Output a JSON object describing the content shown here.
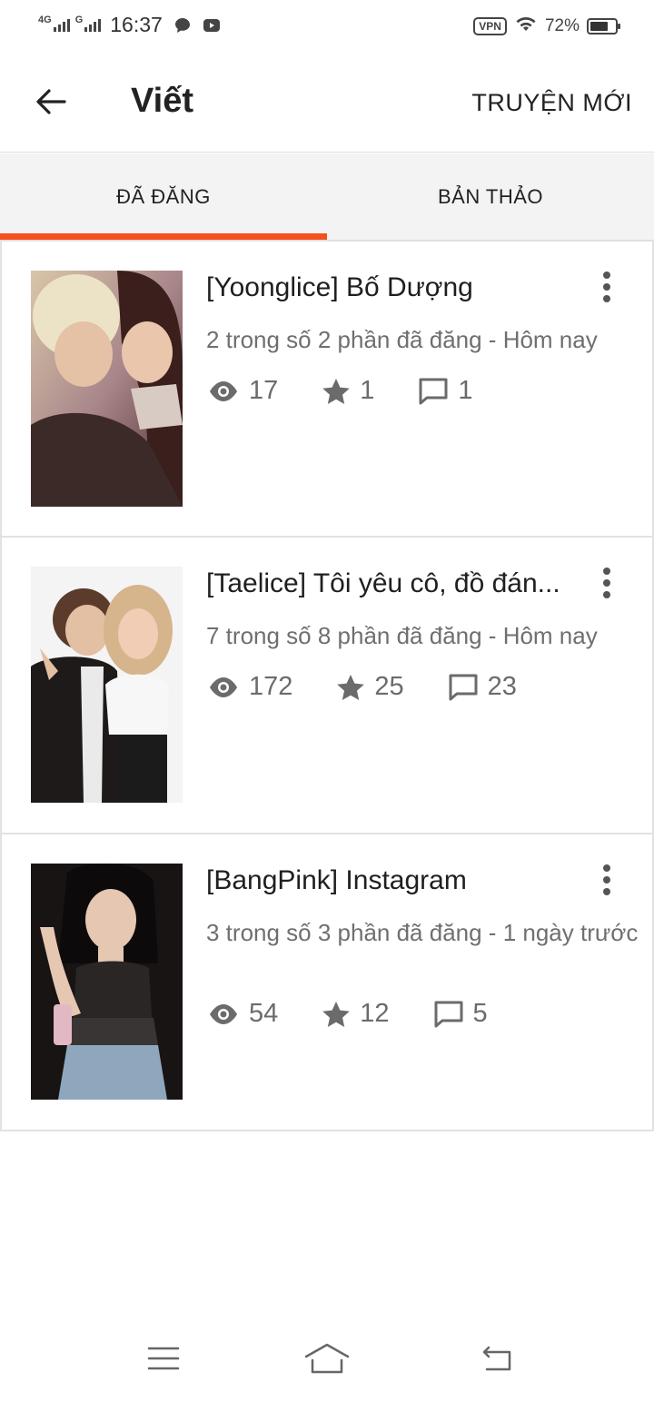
{
  "status_bar": {
    "network_1": "4G",
    "network_2": "G",
    "time": "16:37",
    "vpn": "VPN",
    "battery_percent": "72%",
    "battery_level": 0.72
  },
  "app_bar": {
    "title": "Viết",
    "new_story_label": "TRUYỆN MỚI"
  },
  "tabs": [
    {
      "label": "ĐÃ ĐĂNG",
      "active": true
    },
    {
      "label": "BẢN THẢO",
      "active": false
    }
  ],
  "stories": [
    {
      "title": "[Yoonglice] Bố Dượng",
      "meta": "2 trong số 2 phần đã đăng - Hôm nay",
      "views": "17",
      "votes": "1",
      "comments": "1"
    },
    {
      "title": "[Taelice] Tôi yêu cô, đồ đán...",
      "meta": "7 trong số 8 phần đã đăng - Hôm nay",
      "views": "172",
      "votes": "25",
      "comments": "23"
    },
    {
      "title": "[BangPink] Instagram",
      "meta": "3 trong số 3 phần đã đăng - 1 ngày trước",
      "views": "54",
      "votes": "12",
      "comments": "5"
    }
  ],
  "icons": {
    "back": "arrow-left-icon",
    "views": "eye-icon",
    "votes": "star-icon",
    "comments": "comment-icon",
    "more": "more-vertical-icon",
    "nav_menu": "menu-icon",
    "nav_home": "home-icon",
    "nav_back": "return-icon"
  },
  "colors": {
    "accent": "#f4511e",
    "text_primary": "#1f1f1f",
    "text_secondary": "#6f6f6f",
    "tab_background": "#f3f3f3"
  }
}
